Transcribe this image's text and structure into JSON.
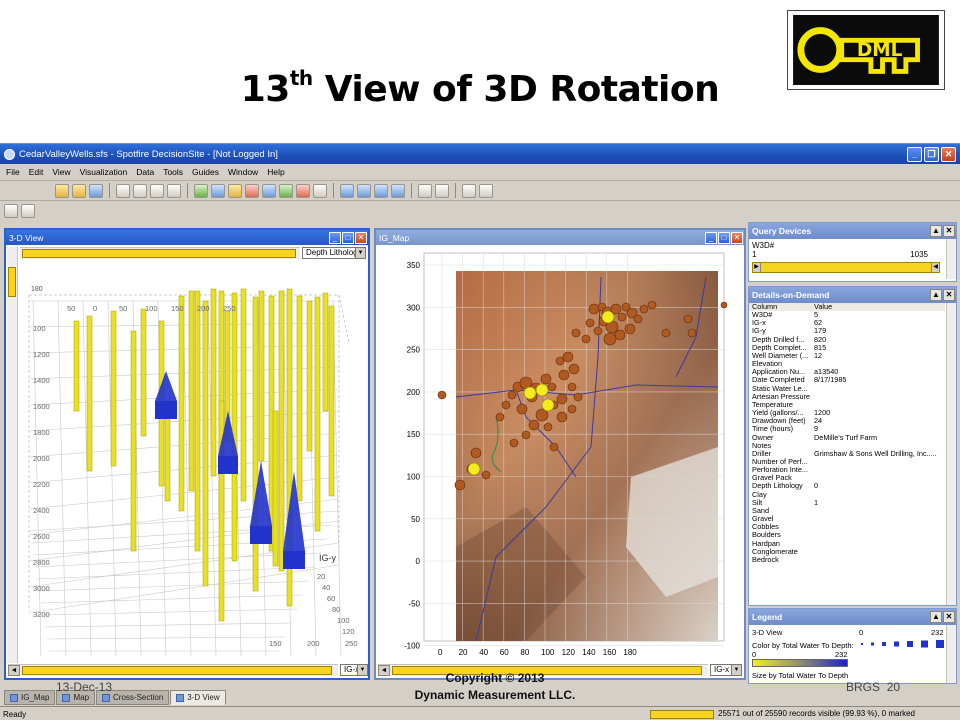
{
  "slide": {
    "title_number": "13",
    "title_sup": "th",
    "title_rest": " View of 3D Rotation",
    "logo_text": "DML",
    "footer_date": "13-Dec-13",
    "footer_copyright": "Copyright © 2013",
    "footer_company": "Dynamic Measurement LLC.",
    "footer_right": "BRGS",
    "footer_page": "20"
  },
  "app": {
    "window_title": "CedarValleyWells.sfs - Spotfire DecisionSite - [Not Logged In]",
    "menu": [
      "File",
      "Edit",
      "View",
      "Visualization",
      "Data",
      "Tools",
      "Guides",
      "Window",
      "Help"
    ],
    "status": "Ready",
    "records": "25571 out of 25590 records visible (99.93 %), 0 marked"
  },
  "view3d": {
    "title": "3-D View",
    "dropdown": "Depth Lithology",
    "ig_y_label": "IG-y",
    "axis_dropdown": "IG-x",
    "top_ticks": [
      "50",
      "0",
      "50",
      "100",
      "150",
      "200",
      "250"
    ],
    "left_ticks": [
      "180",
      "100",
      "1200",
      "1400",
      "1600",
      "1800",
      "2000",
      "2200",
      "2400",
      "2600",
      "2800",
      "3000",
      "3200"
    ],
    "right_ticks": [
      "20",
      "40",
      "60",
      "80",
      "100",
      "120"
    ],
    "bottom_ticks": [
      "150",
      "200",
      "250"
    ]
  },
  "igmap": {
    "title": "IG_Map",
    "axis_dropdown": "IG-x",
    "y_ticks": [
      "350",
      "300",
      "250",
      "200",
      "150",
      "100",
      "50",
      "0",
      "-50",
      "-100"
    ],
    "x_ticks": [
      "0",
      "20",
      "40",
      "60",
      "80",
      "100",
      "120",
      "140",
      "160",
      "180"
    ]
  },
  "query": {
    "title": "Query Devices",
    "field": "W3D#",
    "min": "1",
    "max": "1035"
  },
  "details": {
    "title": "Details-on-Demand",
    "header": [
      "Column",
      "Value"
    ],
    "rows": [
      [
        "W3D#",
        "5"
      ],
      [
        "IG-x",
        "62"
      ],
      [
        "IG-y",
        "179"
      ],
      [
        "Depth Drilled f...",
        "820"
      ],
      [
        "Depth Complet...",
        "815"
      ],
      [
        "Well Diameter (...",
        "12"
      ],
      [
        "Elevation",
        ""
      ],
      [
        "Application Nu...",
        "a13540"
      ],
      [
        "Date Completed",
        "8/17/1985"
      ],
      [
        "Static Water Le...",
        ""
      ],
      [
        "Artesian Pressure",
        ""
      ],
      [
        "Temperature",
        ""
      ],
      [
        "Yield (gallons/...",
        "1200"
      ],
      [
        "Drawdown (feet)",
        "24"
      ],
      [
        "Time (hours)",
        "9"
      ],
      [
        "Owner",
        "DeMille's Turf Farm"
      ],
      [
        "Notes",
        ""
      ],
      [
        "Driller",
        "Grimshaw & Sons Well Drilling, Inc....."
      ],
      [
        "Number of Perf...",
        ""
      ],
      [
        "Perforation Inte...",
        ""
      ],
      [
        "Gravel Pack",
        ""
      ],
      [
        "Depth Lithology",
        "0"
      ],
      [
        "Clay",
        ""
      ],
      [
        "Silt",
        "1"
      ],
      [
        "Sand",
        ""
      ],
      [
        "Gravel",
        ""
      ],
      [
        "Cobbles",
        ""
      ],
      [
        "Boulders",
        ""
      ],
      [
        "Hardpan",
        ""
      ],
      [
        "Conglomerate",
        ""
      ],
      [
        "Bedrock",
        ""
      ]
    ]
  },
  "legend": {
    "title": "Legend",
    "view": "3-D View",
    "color_label": "Color by Total Water To Depth:",
    "color_min": "0",
    "color_max": "232",
    "size_label": "Size by Total Water To Depth",
    "size_min": "0",
    "size_max": "232"
  },
  "tabs": [
    "IG_Map",
    "Map",
    "Cross-Section",
    "3-D View"
  ],
  "colors": {
    "title_bar": "#2556c4",
    "accent_yellow": "#f6d420",
    "well_yellow": "#e8e020",
    "well_blue": "#2233cc"
  }
}
